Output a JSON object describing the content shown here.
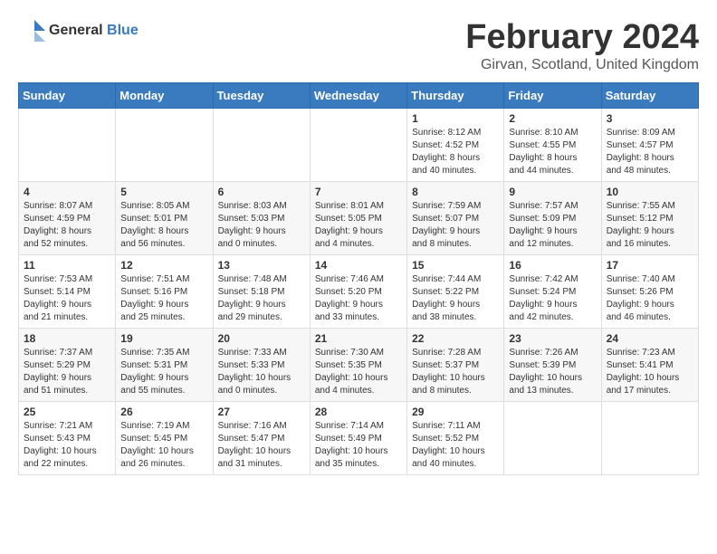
{
  "header": {
    "logo_general": "General",
    "logo_blue": "Blue",
    "month_title": "February 2024",
    "location": "Girvan, Scotland, United Kingdom"
  },
  "days_of_week": [
    "Sunday",
    "Monday",
    "Tuesday",
    "Wednesday",
    "Thursday",
    "Friday",
    "Saturday"
  ],
  "weeks": [
    [
      {
        "day": "",
        "content": ""
      },
      {
        "day": "",
        "content": ""
      },
      {
        "day": "",
        "content": ""
      },
      {
        "day": "",
        "content": ""
      },
      {
        "day": "1",
        "content": "Sunrise: 8:12 AM\nSunset: 4:52 PM\nDaylight: 8 hours\nand 40 minutes."
      },
      {
        "day": "2",
        "content": "Sunrise: 8:10 AM\nSunset: 4:55 PM\nDaylight: 8 hours\nand 44 minutes."
      },
      {
        "day": "3",
        "content": "Sunrise: 8:09 AM\nSunset: 4:57 PM\nDaylight: 8 hours\nand 48 minutes."
      }
    ],
    [
      {
        "day": "4",
        "content": "Sunrise: 8:07 AM\nSunset: 4:59 PM\nDaylight: 8 hours\nand 52 minutes."
      },
      {
        "day": "5",
        "content": "Sunrise: 8:05 AM\nSunset: 5:01 PM\nDaylight: 8 hours\nand 56 minutes."
      },
      {
        "day": "6",
        "content": "Sunrise: 8:03 AM\nSunset: 5:03 PM\nDaylight: 9 hours\nand 0 minutes."
      },
      {
        "day": "7",
        "content": "Sunrise: 8:01 AM\nSunset: 5:05 PM\nDaylight: 9 hours\nand 4 minutes."
      },
      {
        "day": "8",
        "content": "Sunrise: 7:59 AM\nSunset: 5:07 PM\nDaylight: 9 hours\nand 8 minutes."
      },
      {
        "day": "9",
        "content": "Sunrise: 7:57 AM\nSunset: 5:09 PM\nDaylight: 9 hours\nand 12 minutes."
      },
      {
        "day": "10",
        "content": "Sunrise: 7:55 AM\nSunset: 5:12 PM\nDaylight: 9 hours\nand 16 minutes."
      }
    ],
    [
      {
        "day": "11",
        "content": "Sunrise: 7:53 AM\nSunset: 5:14 PM\nDaylight: 9 hours\nand 21 minutes."
      },
      {
        "day": "12",
        "content": "Sunrise: 7:51 AM\nSunset: 5:16 PM\nDaylight: 9 hours\nand 25 minutes."
      },
      {
        "day": "13",
        "content": "Sunrise: 7:48 AM\nSunset: 5:18 PM\nDaylight: 9 hours\nand 29 minutes."
      },
      {
        "day": "14",
        "content": "Sunrise: 7:46 AM\nSunset: 5:20 PM\nDaylight: 9 hours\nand 33 minutes."
      },
      {
        "day": "15",
        "content": "Sunrise: 7:44 AM\nSunset: 5:22 PM\nDaylight: 9 hours\nand 38 minutes."
      },
      {
        "day": "16",
        "content": "Sunrise: 7:42 AM\nSunset: 5:24 PM\nDaylight: 9 hours\nand 42 minutes."
      },
      {
        "day": "17",
        "content": "Sunrise: 7:40 AM\nSunset: 5:26 PM\nDaylight: 9 hours\nand 46 minutes."
      }
    ],
    [
      {
        "day": "18",
        "content": "Sunrise: 7:37 AM\nSunset: 5:29 PM\nDaylight: 9 hours\nand 51 minutes."
      },
      {
        "day": "19",
        "content": "Sunrise: 7:35 AM\nSunset: 5:31 PM\nDaylight: 9 hours\nand 55 minutes."
      },
      {
        "day": "20",
        "content": "Sunrise: 7:33 AM\nSunset: 5:33 PM\nDaylight: 10 hours\nand 0 minutes."
      },
      {
        "day": "21",
        "content": "Sunrise: 7:30 AM\nSunset: 5:35 PM\nDaylight: 10 hours\nand 4 minutes."
      },
      {
        "day": "22",
        "content": "Sunrise: 7:28 AM\nSunset: 5:37 PM\nDaylight: 10 hours\nand 8 minutes."
      },
      {
        "day": "23",
        "content": "Sunrise: 7:26 AM\nSunset: 5:39 PM\nDaylight: 10 hours\nand 13 minutes."
      },
      {
        "day": "24",
        "content": "Sunrise: 7:23 AM\nSunset: 5:41 PM\nDaylight: 10 hours\nand 17 minutes."
      }
    ],
    [
      {
        "day": "25",
        "content": "Sunrise: 7:21 AM\nSunset: 5:43 PM\nDaylight: 10 hours\nand 22 minutes."
      },
      {
        "day": "26",
        "content": "Sunrise: 7:19 AM\nSunset: 5:45 PM\nDaylight: 10 hours\nand 26 minutes."
      },
      {
        "day": "27",
        "content": "Sunrise: 7:16 AM\nSunset: 5:47 PM\nDaylight: 10 hours\nand 31 minutes."
      },
      {
        "day": "28",
        "content": "Sunrise: 7:14 AM\nSunset: 5:49 PM\nDaylight: 10 hours\nand 35 minutes."
      },
      {
        "day": "29",
        "content": "Sunrise: 7:11 AM\nSunset: 5:52 PM\nDaylight: 10 hours\nand 40 minutes."
      },
      {
        "day": "",
        "content": ""
      },
      {
        "day": "",
        "content": ""
      }
    ]
  ]
}
